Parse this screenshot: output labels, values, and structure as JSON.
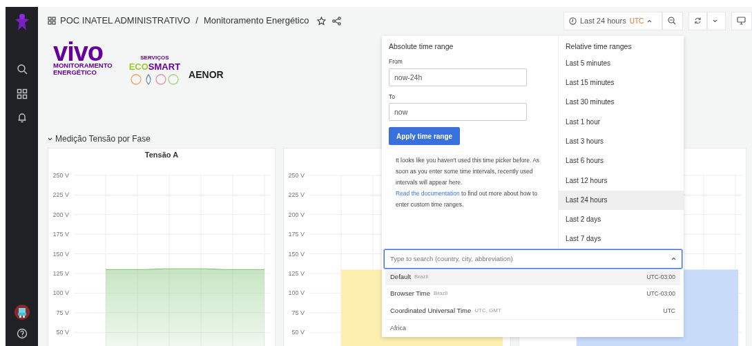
{
  "header": {
    "folder": "POC INATEL ADMINISTRATIVO",
    "separator": "/",
    "title": "Monitoramento Energético",
    "starred": false
  },
  "time_picker": {
    "label": "Last 24 hours",
    "timezone": "UTC",
    "expanded": true
  },
  "logos": {
    "vivo": "vivo",
    "vivo_lines": [
      "MONITORAMENTO",
      "ENERGÉTICO"
    ],
    "eco_top": "SERVIÇOS",
    "eco_green": "ECO",
    "eco_purple": "SMART",
    "aenor": "AENOR"
  },
  "row": {
    "title": "Medição Tensão por Fase",
    "expanded": true
  },
  "panels": [
    {
      "title": "Tensão A",
      "chart_data": {
        "type": "area",
        "yticks": [
          {
            "value": 250,
            "label": "250 V"
          },
          {
            "value": 225,
            "label": "225 V"
          },
          {
            "value": 200,
            "label": "200 V"
          },
          {
            "value": 175,
            "label": "175 V"
          },
          {
            "value": 150,
            "label": "150 V"
          },
          {
            "value": 125,
            "label": "125 V"
          },
          {
            "value": 100,
            "label": "100 V"
          },
          {
            "value": 75,
            "label": "75 V"
          },
          {
            "value": 50,
            "label": "50 V"
          }
        ],
        "ylim": [
          50,
          250
        ],
        "grid": true,
        "series": [
          {
            "color": "#73bf69",
            "values": [
              130,
              130,
              130,
              131,
              131,
              131,
              130,
              130,
              130
            ]
          }
        ]
      }
    },
    {
      "axis_labels": [
        "250 V",
        "225 V",
        "200 V",
        "175 V",
        "150 V",
        "125 V",
        "100 V",
        "75 V",
        "50 V"
      ],
      "color": "#fcefb0"
    },
    {
      "color": "#c8dcfa"
    }
  ],
  "time_popover": {
    "absolute_title": "Absolute time range",
    "from_label": "From",
    "from_value": "now-24h",
    "to_label": "To",
    "to_value": "now",
    "apply_button": "Apply time range",
    "help_text": "It looks like you haven't used this time picker before. As soon as you enter some time intervals, recently used intervals will appear here.",
    "doc_link": "Read the documentation",
    "doc_text": " to find out more about how to enter custom time ranges.",
    "relative_title": "Relative time ranges",
    "relative_ranges": [
      {
        "label": "Last 5 minutes",
        "selected": false
      },
      {
        "label": "Last 15 minutes",
        "selected": false
      },
      {
        "label": "Last 30 minutes",
        "selected": false
      },
      {
        "label": "Last 1 hour",
        "selected": false
      },
      {
        "label": "Last 3 hours",
        "selected": false
      },
      {
        "label": "Last 6 hours",
        "selected": false
      },
      {
        "label": "Last 12 hours",
        "selected": false
      },
      {
        "label": "Last 24 hours",
        "selected": true
      },
      {
        "label": "Last 2 days",
        "selected": false
      },
      {
        "label": "Last 7 days",
        "selected": false
      }
    ]
  },
  "timezone_select": {
    "placeholder": "Type to search (country, city, abbreviation)",
    "expanded": true,
    "options": [
      {
        "kind": "zone",
        "name": "Default",
        "region": "Brazil",
        "offset": "UTC-03:00",
        "selected": true
      },
      {
        "kind": "zone",
        "name": "Browser Time",
        "region": "Brazil",
        "offset": "UTC-03:00",
        "selected": false
      },
      {
        "kind": "zone",
        "name": "Coordinated Universal Time",
        "region": "UTC, GMT",
        "offset": "UTC",
        "selected": false
      },
      {
        "kind": "group",
        "name": "Africa"
      }
    ]
  }
}
